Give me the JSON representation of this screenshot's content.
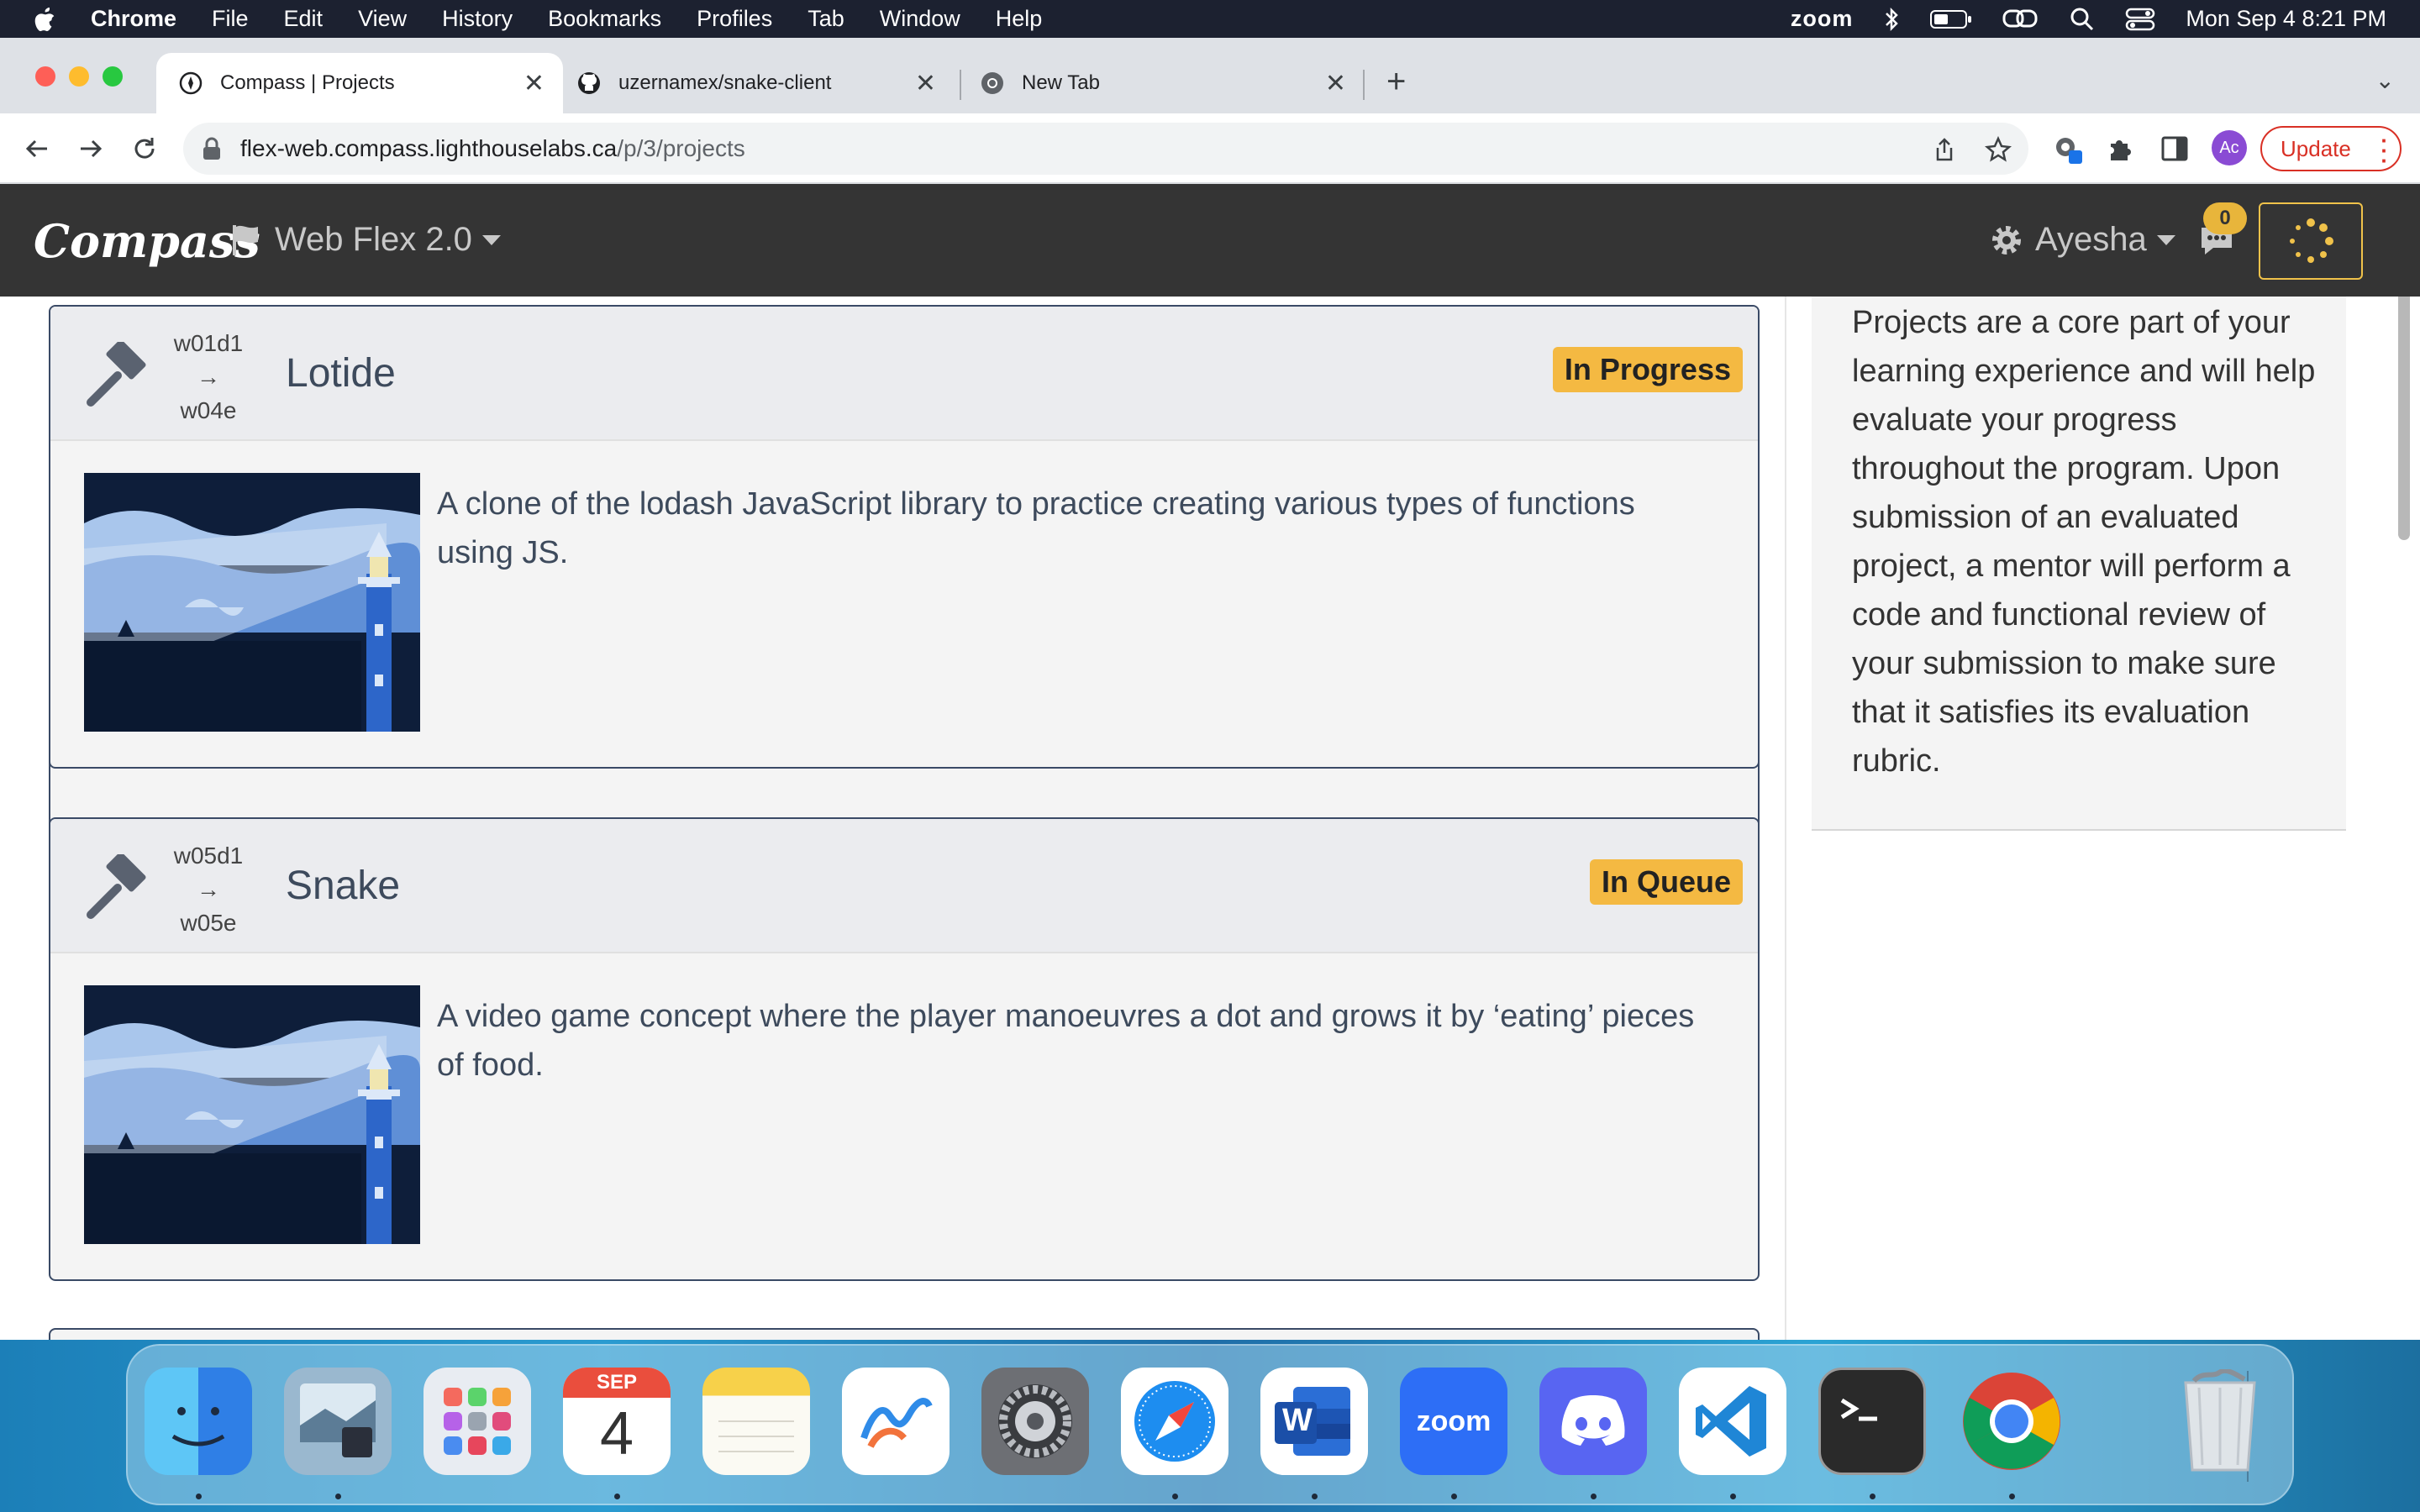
{
  "menubar": {
    "app_name": "Chrome",
    "items": [
      "File",
      "Edit",
      "View",
      "History",
      "Bookmarks",
      "Profiles",
      "Tab",
      "Window",
      "Help"
    ],
    "zoom_label": "zoom",
    "datetime": "Mon Sep 4  8:21 PM"
  },
  "browser": {
    "tabs": [
      {
        "title": "Compass | Projects",
        "icon": "compass-favicon-icon",
        "active": true
      },
      {
        "title": "uzernamex/snake-client",
        "icon": "github-icon",
        "active": false
      },
      {
        "title": "New Tab",
        "icon": "chrome-icon",
        "active": false
      }
    ],
    "url_host": "flex-web.compass.lighthouselabs.ca",
    "url_path": "/p/3/projects",
    "profile_initials": "Ac",
    "update_label": "Update"
  },
  "site": {
    "logo": "Compass",
    "cohort": "Web Flex 2.0",
    "user": "Ayesha",
    "chat_count": "0"
  },
  "projects": [
    {
      "start": "w01d1",
      "arrow": "→",
      "end": "w04e",
      "title": "Lotide",
      "status": "In Progress",
      "description": "A clone of the lodash JavaScript library to practice creating various types of functions using JS."
    },
    {
      "start": "w05d1",
      "arrow": "→",
      "end": "w05e",
      "title": "Snake",
      "status": "In Queue",
      "description": "A video game concept where the player manoeuvres a dot and grows it by ‘eating’ pieces of food."
    }
  ],
  "sidebar_text": "Projects are a core part of your learning experience and will help evaluate your progress throughout the program. Upon submission of an evaluated project, a mentor will perform a code and functional review of your submission to make sure that it satisfies its evaluation rubric.",
  "dock": {
    "calendar_month": "SEP",
    "calendar_day": "4",
    "zoom_label": "zoom",
    "word_letter": "W"
  },
  "colors": {
    "status_badge": "#f4b942",
    "site_nav": "#343434",
    "card_border": "#3a4a66"
  }
}
